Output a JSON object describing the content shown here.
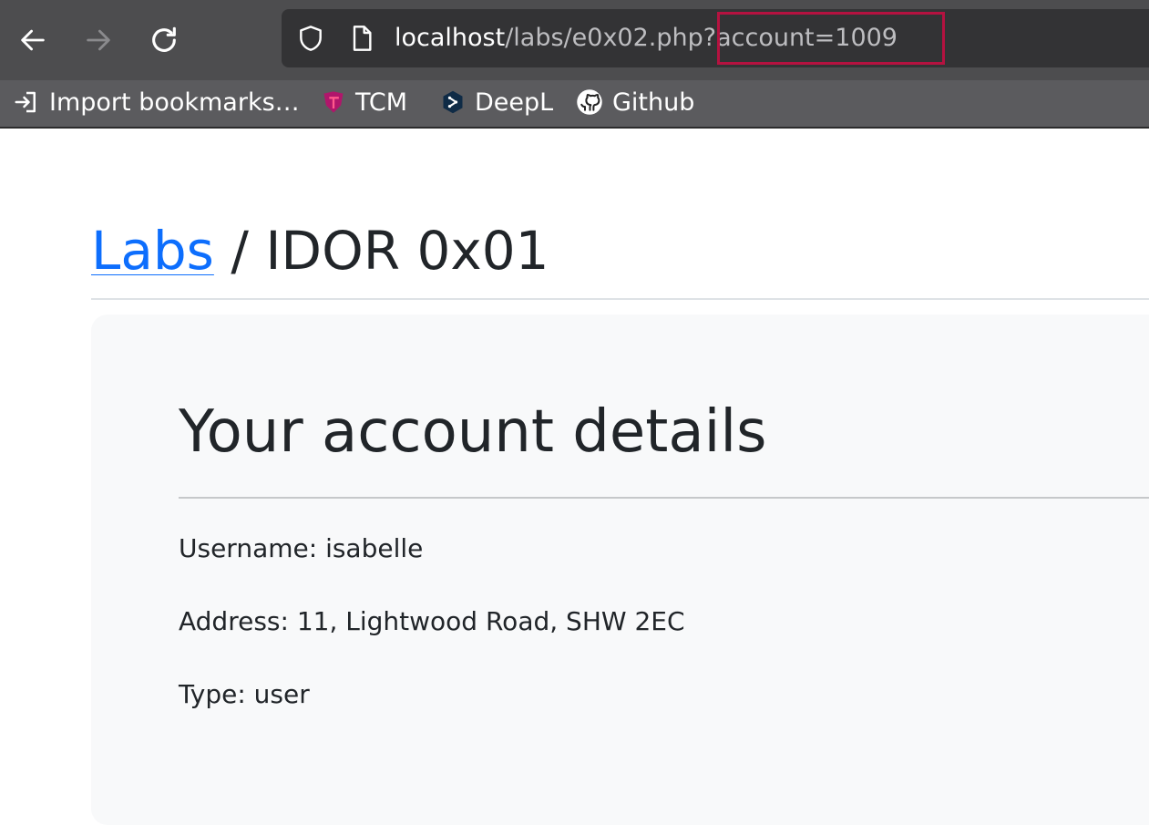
{
  "browser": {
    "url": {
      "host": "localhost",
      "path": "/labs/e0x02.php",
      "query": "?account=1009"
    },
    "bookmarks": [
      {
        "label": "Import bookmarks…",
        "icon": "import-icon"
      },
      {
        "label": "TCM",
        "icon": "tcm-icon"
      },
      {
        "label": "DeepL",
        "icon": "deepl-icon"
      },
      {
        "label": "Github",
        "icon": "github-icon"
      }
    ],
    "colors": {
      "toolbar": "#4d4d4f",
      "urlbar": "#333335",
      "highlight": "#b51240"
    }
  },
  "page": {
    "breadcrumb": {
      "link": "Labs",
      "separator": " / ",
      "current": "IDOR 0x01"
    },
    "card": {
      "title": "Your account details",
      "username": "Username: isabelle",
      "address": "Address: 11, Lightwood Road, SHW 2EC",
      "type": "Type: user"
    },
    "colors": {
      "link": "#0d6efd",
      "text": "#212529",
      "card_bg": "#f8f9fa"
    }
  }
}
